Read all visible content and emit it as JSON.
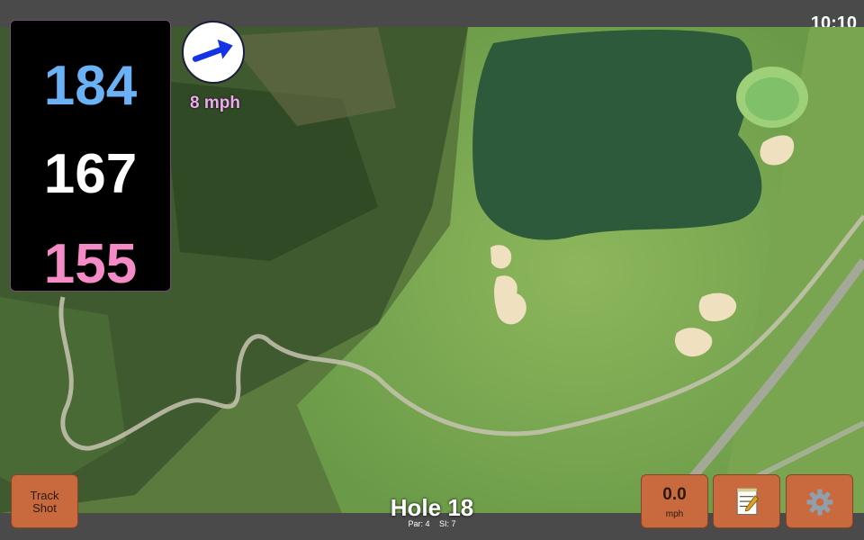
{
  "status": {
    "time": "10:10"
  },
  "yardages": [
    {
      "label": "184",
      "color": "#6ab1f5"
    },
    {
      "label": "167",
      "color": "#ffffff"
    },
    {
      "label": "155",
      "color": "#f58bc6"
    }
  ],
  "wind": {
    "speed_label": "8 mph",
    "icon": "wind-arrow-icon"
  },
  "buttons": {
    "track_shot": [
      "Track",
      "Shot"
    ],
    "speed_value": "0.0",
    "speed_unit": "mph",
    "notes_icon": "notepad-icon",
    "settings_icon": "gear-icon"
  },
  "hole": {
    "title": "Hole 18",
    "par": "Par: 4",
    "si": "SI: 7"
  },
  "colors": {
    "button": "#c9693e",
    "bar": "#4a4a4a"
  }
}
